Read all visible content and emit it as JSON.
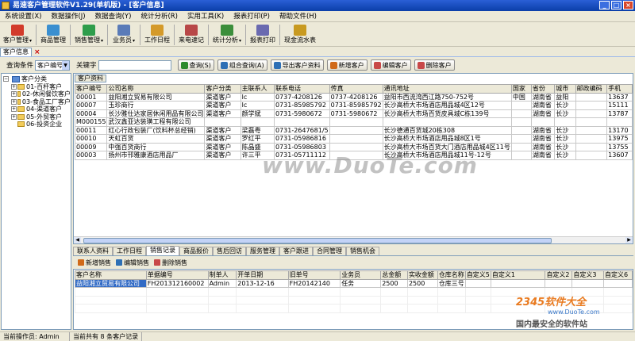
{
  "window": {
    "title": "易速客户管理软件V1.29(单机版) - [客户信息]"
  },
  "menus": [
    "系统设置(X)",
    "数据操作(J)",
    "数据查询(Y)",
    "统计分析(R)",
    "实用工具(K)",
    "报表打印(P)",
    "帮助文件(H)"
  ],
  "toolbar": [
    {
      "label": "客户管理",
      "dropdown": true,
      "color": "#d23b2b"
    },
    {
      "label": "商品管理",
      "dropdown": false,
      "color": "#3a8fd0"
    },
    {
      "label": "销售管理",
      "dropdown": true,
      "color": "#2e9d4b"
    },
    {
      "label": "业务员",
      "dropdown": true,
      "color": "#5a7bb8"
    },
    {
      "label": "工作日程",
      "dropdown": false,
      "color": "#d49a2a"
    },
    {
      "label": "来电速记",
      "dropdown": false,
      "color": "#b84848"
    },
    {
      "label": "统计分析",
      "dropdown": true,
      "color": "#3b8e3b"
    },
    {
      "label": "报表打印",
      "dropdown": false,
      "color": "#6a6ab0"
    },
    {
      "label": "现金流水表",
      "dropdown": false,
      "color": "#c89a20"
    }
  ],
  "doc_tab": {
    "label": "客户信息"
  },
  "search": {
    "condition_label": "查询条件",
    "condition_value": "客户编号",
    "keyword_label": "关键字",
    "keyword_value": "",
    "buttons": [
      {
        "label": "查询(S)",
        "color": "#2d8a2d"
      },
      {
        "label": "组合查询(A)",
        "color": "#2d6fb5"
      },
      {
        "label": "导出客户资料",
        "color": "#2d6fb5"
      },
      {
        "label": "新增客户",
        "color": "#d06a1a"
      },
      {
        "label": "编辑客户",
        "color": "#c84848"
      },
      {
        "label": "删除客户",
        "color": "#c84848"
      }
    ]
  },
  "tree": {
    "root": "客户分类",
    "items": [
      "01-百杆客户",
      "02-休闲餐饮客户",
      "03-食品工厂客户",
      "04-渠道客户",
      "05-外贸客户",
      "06-投资企业"
    ]
  },
  "customer_subtab": "客户资料",
  "customer_table": {
    "columns": [
      "客户编号",
      "公司名称",
      "客户分类",
      "主联系人",
      "联系电话",
      "传真",
      "通讯地址",
      "国家",
      "省份",
      "城市",
      "邮政编码",
      "手机"
    ],
    "rows": [
      [
        "00001",
        "益阳湘立贸易有限公司",
        "渠道客户",
        "lc",
        "0737-4208126",
        "0737-4208126",
        "益阳市西流湾西江路750-752号",
        "中国",
        "湖南省",
        "益阳",
        "",
        "13637"
      ],
      [
        "00007",
        "玉珍商行",
        "渠道客户",
        "lc",
        "0731-85985792",
        "0731-85985792",
        "长沙高桥大市场酒店用品城4区12号",
        "",
        "湖南省",
        "长沙",
        "",
        "15111"
      ],
      [
        "00004",
        "长沙雅仕达家居休闲用品有限公司",
        "渠道客户",
        "颜学斌",
        "0731-5980672",
        "0731-5980672",
        "长沙高桥大市场百货皮具城C栋139号",
        "",
        "湖南省",
        "长沙",
        "",
        "13787"
      ],
      [
        "M000155",
        "武汉鑫亚达装璜工程有限公司",
        "",
        "",
        "",
        "",
        "",
        "",
        "",
        "",
        "",
        ""
      ],
      [
        "00011",
        "红心行政包装厂(饮料杯总经销)",
        "渠道客户",
        "梁磊粤",
        "0731-2647681/5",
        "",
        "长沙德通百货城20栋308",
        "",
        "湖南省",
        "长沙",
        "",
        "13170"
      ],
      [
        "00010",
        "天虹百货",
        "渠道客户",
        "罗红平",
        "0731-05986816",
        "",
        "长沙高桥大市场酒店用品城8区1号",
        "",
        "湖南省",
        "长沙",
        "",
        "13975"
      ],
      [
        "00009",
        "中强百货商行",
        "渠道客户",
        "陈晶盛",
        "0731-05986803",
        "",
        "长沙高桥大市场百货大门酒店用品城4区11号",
        "",
        "湖南省",
        "长沙",
        "",
        "13755"
      ],
      [
        "00003",
        "扬州市邗雅康酒店用品厂",
        "渠道客户",
        "许三平",
        "0731-05711112",
        "",
        "长沙高桥大市场酒店用品城11号-12号",
        "",
        "湖南省",
        "长沙",
        "",
        "13607"
      ]
    ]
  },
  "bottom_tabs": [
    "联系人资料",
    "工作日程",
    "销售记录",
    "商品报价",
    "售后回访",
    "服务管理",
    "客户跟进",
    "合同管理",
    "销售机会"
  ],
  "bottom_active_tab": "销售记录",
  "bottom_actions": [
    {
      "label": "新增销售",
      "color": "#d06a1a"
    },
    {
      "label": "编辑销售",
      "color": "#2d6fb5"
    },
    {
      "label": "删除销售",
      "color": "#c84848"
    }
  ],
  "sales_table": {
    "columns": [
      "客户名称",
      "单据编号",
      "制单人",
      "开单日期",
      "旧单号",
      "业务员",
      "总金额",
      "实收金额",
      "仓库名称",
      "自定义5",
      "自定义1",
      "自定义2",
      "自定义3",
      "自定义6"
    ],
    "rows": [
      [
        "益阳湘立贸易有限公司",
        "FH201312160002",
        "Admin",
        "2013-12-16",
        "FH20142140",
        "任务",
        "2500",
        "2500",
        "仓库三号",
        "",
        "",
        "",
        "",
        ""
      ]
    ]
  },
  "status": {
    "operator": "当前操作员: Admin",
    "count": "当前共有 8 条客户记录"
  },
  "watermarks": {
    "main": "www.DuoTe.com",
    "brand": "2345软件大全",
    "brand_url": "www.DuoTe.com",
    "slogan": "国内最安全的软件站"
  }
}
